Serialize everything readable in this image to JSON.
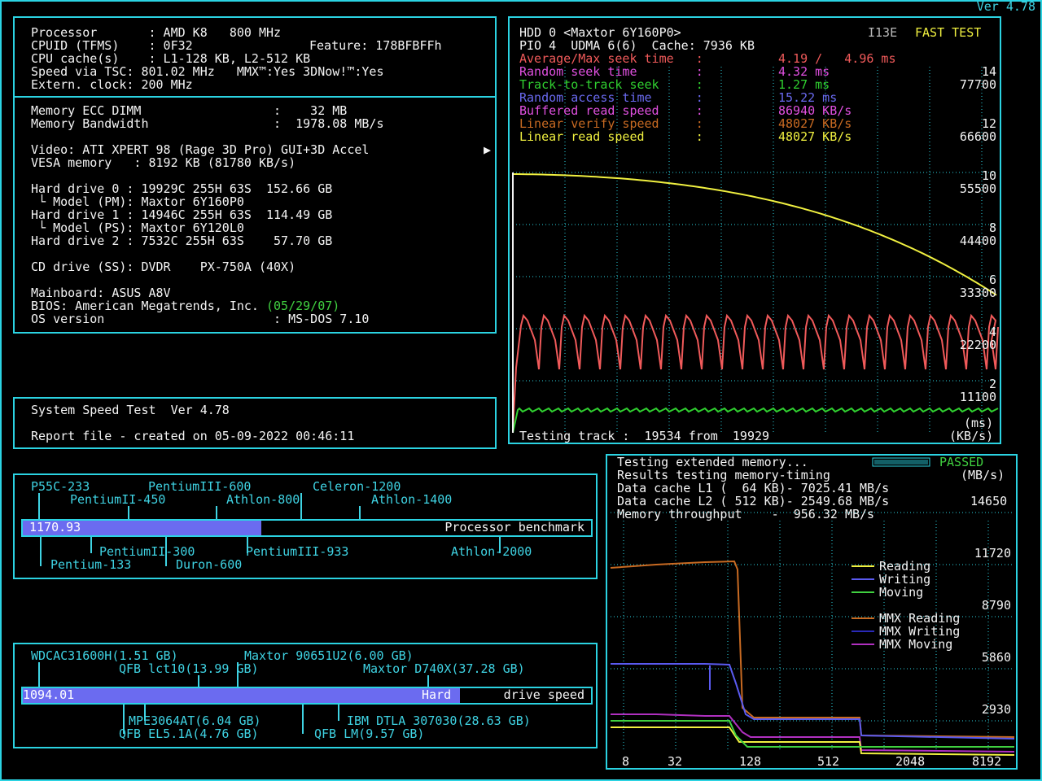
{
  "version": "Ver 4.78",
  "sysinfo": {
    "processor": "Processor       : AMD K8   800 MHz",
    "cpuid": "CPUID (TFMS)    : 0F32",
    "feature": "Feature: 178BFBFFh",
    "cache": "CPU cache(s)    : L1-128 KB, L2-512 KB",
    "tsc": "Speed via TSC: 801.02 MHz   MMX™:Yes 3DNow!™:Yes",
    "clock": "Extern. clock: 200 MHz",
    "mem_ecc": "Memory ECC DIMM                  :    32 MB",
    "mem_bw": "Memory Bandwidth                 :  1978.08 MB/s",
    "video": "Video: ATI XPERT 98 (Rage 3D Pro) GUI+3D Accel",
    "vesa": "VESA memory   : 8192 KB (81780 KB/s)",
    "hd0": "Hard drive 0 : 19929C 255H 63S  152.66 GB",
    "hd0_model": " └ Model (PM): Maxtor 6Y160P0",
    "hd1": "Hard drive 1 : 14946C 255H 63S  114.49 GB",
    "hd1_model": " └ Model (PS): Maxtor 6Y120L0",
    "hd2": "Hard drive 2 : 7532C 255H 63S    57.70 GB",
    "cd": "CD drive (SS): DVDR    PX-750A (40X)",
    "mainboard": "Mainboard: ASUS A8V",
    "bios": "BIOS: American Megatrends, Inc. ",
    "bios_date": "(05/29/07)",
    "os": "OS version                       : MS-DOS 7.10"
  },
  "report": {
    "title": "System Speed Test  Ver 4.78",
    "created": "Report file - created on 05-09-2022 00:46:11"
  },
  "hdd_test": {
    "header": "HDD 0 <Maxtor 6Y160P0>",
    "i13e": "I13E",
    "fast_test": "FAST TEST",
    "pio": "PIO 4  UDMA 6(6)  Cache: 7936 KB",
    "metrics": [
      {
        "label": "Average/Max seek time   :",
        "value": "4.19 /   4.96 ms",
        "color": "#f05a5a"
      },
      {
        "label": "Random seek time        :",
        "value": "4.32 ms",
        "color": "#e050e0"
      },
      {
        "label": "Track-to-track seek     :",
        "value": "1.27 ms",
        "color": "#30d030"
      },
      {
        "label": "Random access time      :",
        "value": "15.22 ms",
        "color": "#6a6af0"
      },
      {
        "label": "Buffered read speed     :",
        "value": "86940 KB/s",
        "color": "#e050e0"
      },
      {
        "label": "Linear verify speed     :",
        "value": "48027 KB/s",
        "color": "#c86a22"
      },
      {
        "label": "Linear read speed       :",
        "value": "48027 KB/s",
        "color": "#f0f040"
      }
    ],
    "ms_axis": [
      "14",
      "12",
      "10",
      "8",
      "6",
      "4",
      "2"
    ],
    "kb_axis": [
      "77700",
      "66600",
      "55500",
      "44400",
      "33300",
      "22200",
      "11100"
    ],
    "testing": "Testing track :  19534 from  19929",
    "unit_ms": "(ms)",
    "unit_kbs": "(KB/s)"
  },
  "memory_test": {
    "line1": "Testing extended memory...",
    "passed": "PASSED",
    "line2": "Results testing memory-timing",
    "unit": "(MB/s)",
    "l1": "Data cache L1 (  64 KB)- 7025.41 MB/s",
    "l2": "Data cache L2 ( 512 KB)- 2549.68 MB/s",
    "l2_scale": "14650",
    "throughput": "Memory throughput    -  956.32 MB/s",
    "y_axis": [
      "11720",
      "8790",
      "5860",
      "2930"
    ],
    "x_axis": [
      "8",
      "32",
      "128",
      "512",
      "2048",
      "8192"
    ],
    "legend": [
      {
        "name": "Reading",
        "color": "#f0f040"
      },
      {
        "name": "Writing",
        "color": "#5a5af0"
      },
      {
        "name": "Moving",
        "color": "#40d040"
      },
      {
        "name": "MMX Reading",
        "color": "#c86a22"
      },
      {
        "name": "MMX Writing",
        "color": "#2a2ab8"
      },
      {
        "name": "MMX Moving",
        "color": "#b030c0"
      }
    ]
  },
  "cpu_bench": {
    "value": "1170.93",
    "caption": "Processor benchmark",
    "fill_fraction": 0.42,
    "labels_top": [
      "P55C-233",
      "PentiumIII-600",
      "Celeron-1200",
      "PentiumII-450",
      "Athlon-800",
      "Athlon-1400"
    ],
    "labels_bottom": [
      "PentiumII-300",
      "PentiumIII-933",
      "Athlon-2000",
      "Pentium-133",
      "Duron-600"
    ]
  },
  "hd_bench": {
    "value": "1094.01",
    "caption_bar": "Hard",
    "caption": "drive speed",
    "fill_fraction": 0.77,
    "labels_top": [
      "WDCAC31600H(1.51 GB)",
      "Maxtor 90651U2(6.00 GB)",
      "QFB lct10(13.99 GB)",
      "Maxtor D740X(37.28 GB)"
    ],
    "labels_bottom": [
      "MPE3064AT(6.04 GB)",
      "IBM DTLA 307030(28.63 GB)",
      "QFB EL5.1A(4.76 GB)",
      "QFB LM(9.57 GB)"
    ]
  }
}
